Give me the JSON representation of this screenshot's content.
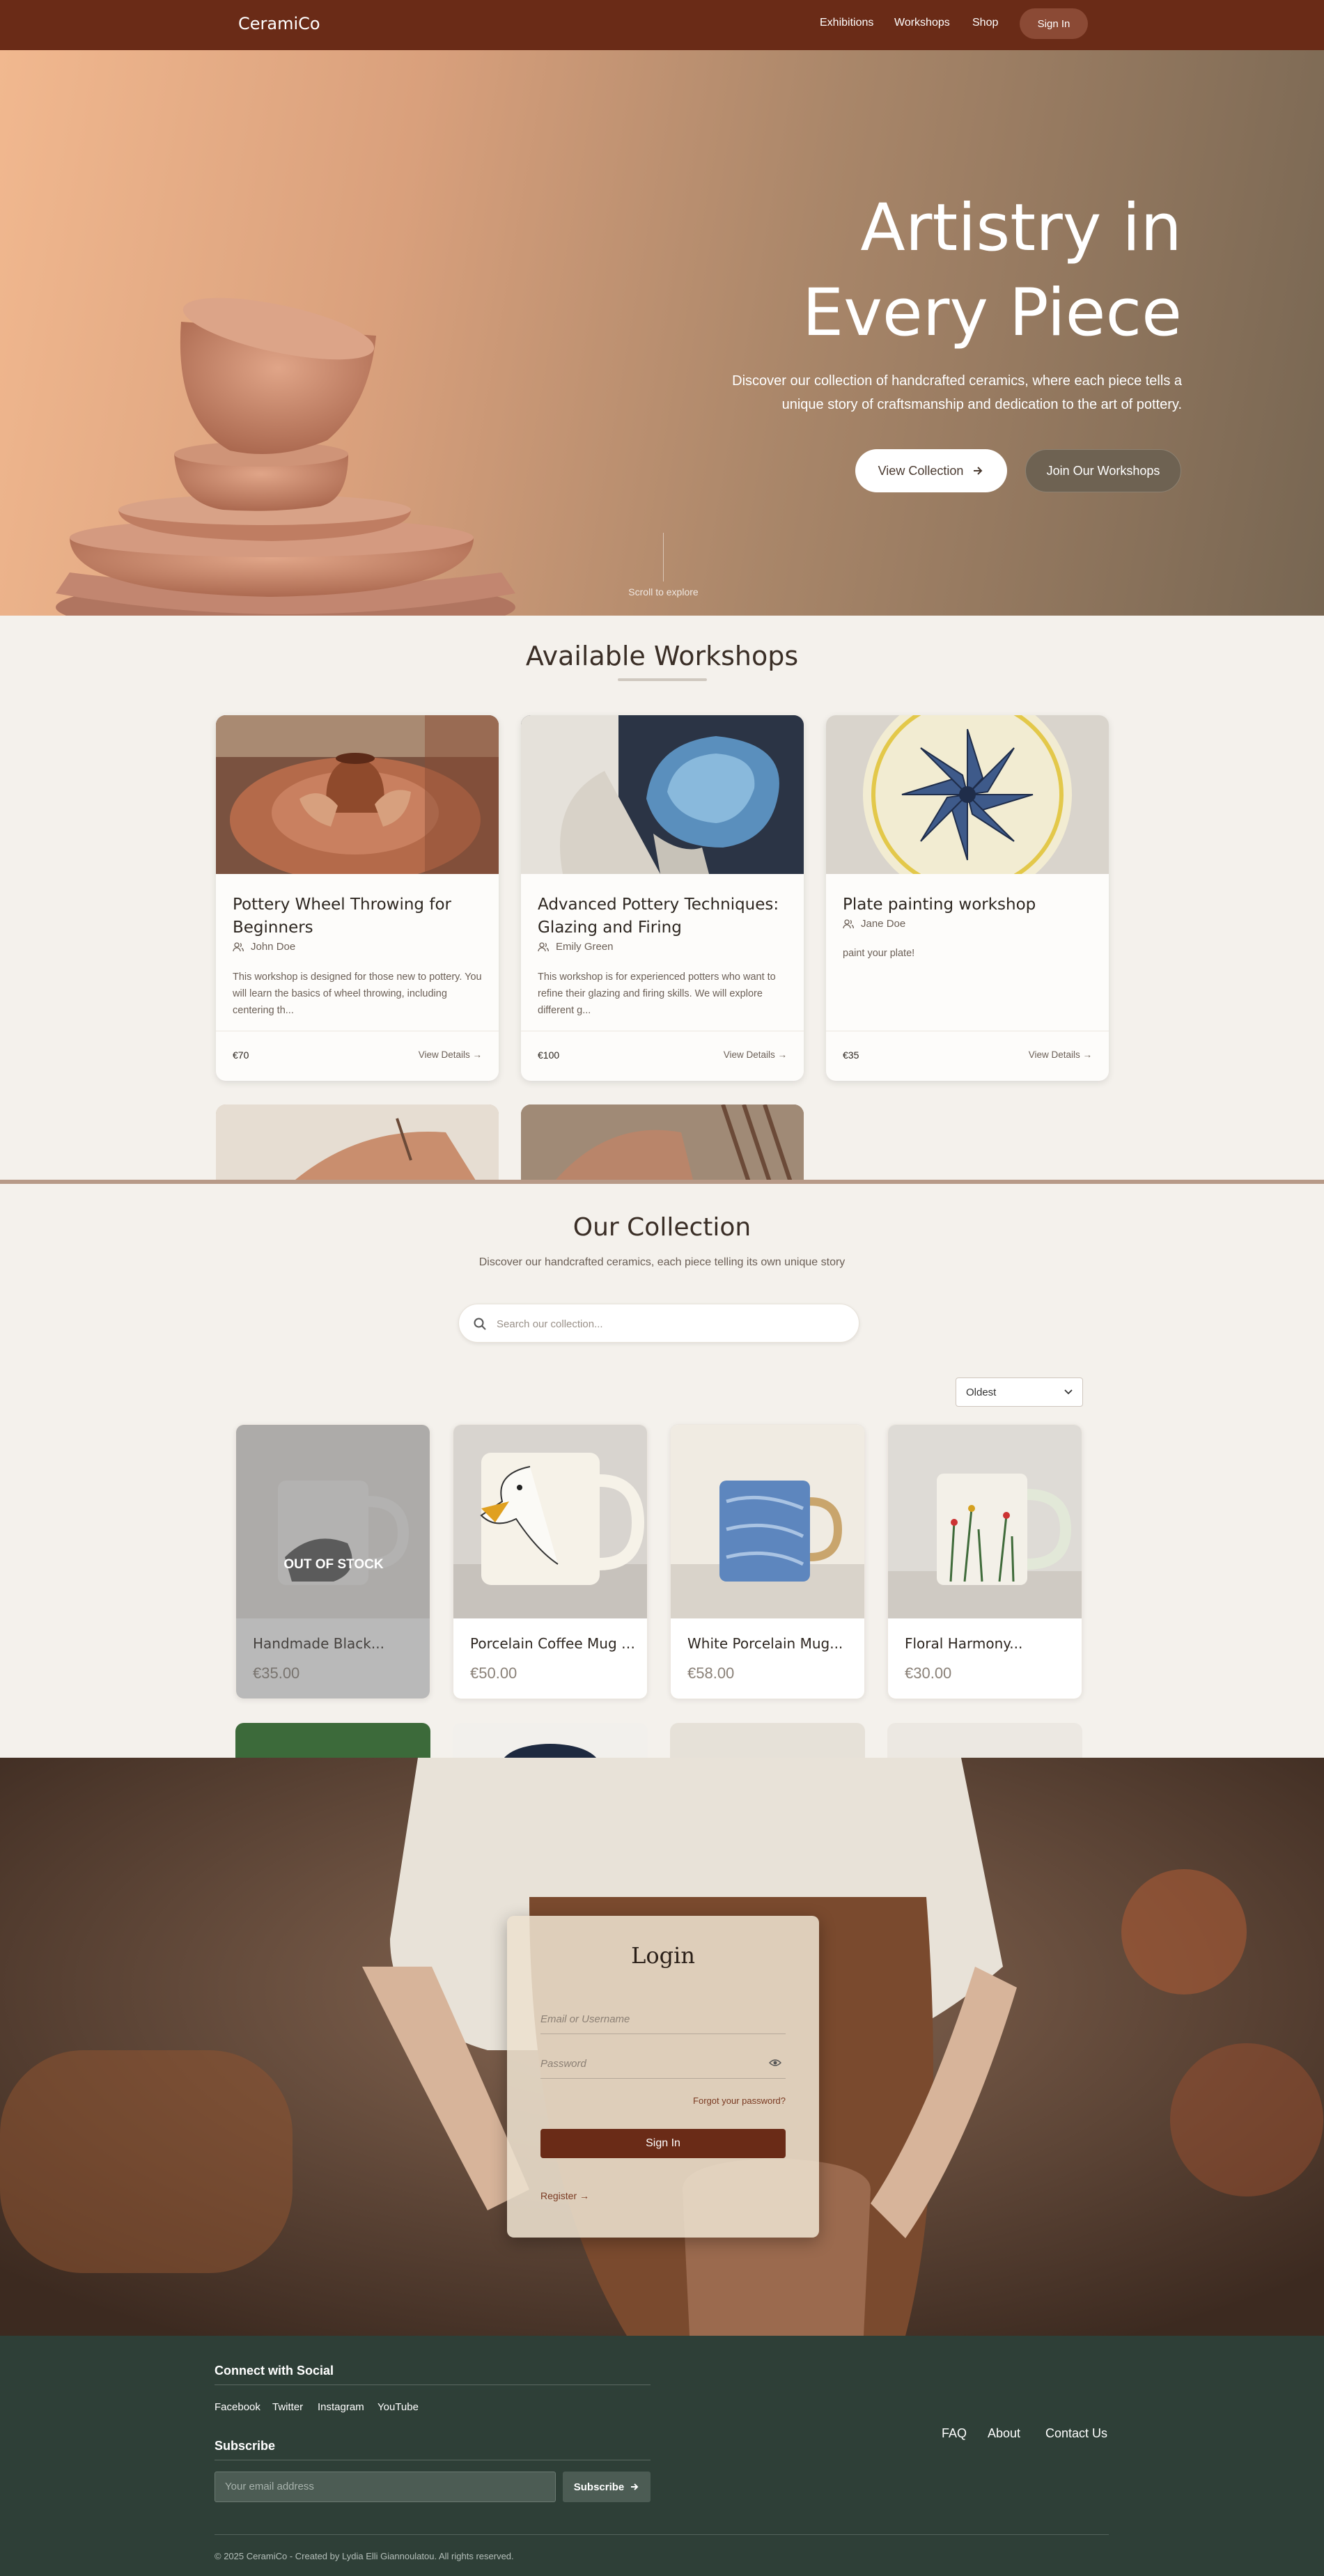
{
  "nav": {
    "brand": "CeramiCo",
    "links": [
      "Exhibitions",
      "Workshops",
      "Shop"
    ],
    "signin": "Sign In"
  },
  "hero": {
    "title_line1": "Artistry in",
    "title_line2": "Every Piece",
    "subtitle_line1": "Discover our collection of handcrafted ceramics, where each piece tells a",
    "subtitle_line2": "unique story of craftsmanship and dedication to the art of pottery.",
    "primary_button": "View Collection",
    "secondary_button": "Join Our Workshops",
    "scroll_hint": "Scroll to explore"
  },
  "workshops": {
    "title": "Available Workshops",
    "cards": [
      {
        "title": "Pottery Wheel Throwing for Beginners",
        "instructor": "John Doe",
        "description": "This workshop is designed for those new to pottery. You will learn the basics of wheel throwing, including centering th...",
        "price": "€70",
        "details": "View Details →"
      },
      {
        "title": "Advanced Pottery Techniques: Glazing and Firing",
        "instructor": "Emily Green",
        "description": "This workshop is for experienced potters who want to refine their glazing and firing skills. We will explore different g...",
        "price": "€100",
        "details": "View Details →"
      },
      {
        "title": "Plate painting workshop",
        "instructor": "Jane Doe",
        "description": "paint your plate!",
        "price": "€35",
        "details": "View Details →"
      }
    ]
  },
  "collection": {
    "title": "Our Collection",
    "subtitle": "Discover our handcrafted ceramics, each piece telling its own unique story",
    "search_placeholder": "Search our collection...",
    "sort_selected": "Oldest",
    "out_of_stock_label": "OUT OF STOCK",
    "products": [
      {
        "name": "Handmade Black...",
        "price": "€35.00"
      },
      {
        "name": "Porcelain Coffee Mug i...",
        "price": "€50.00"
      },
      {
        "name": "White Porcelain Mug...",
        "price": "€58.00"
      },
      {
        "name": "Floral Harmony...",
        "price": "€30.00"
      }
    ]
  },
  "login": {
    "title": "Login",
    "email_placeholder": "Email or Username",
    "password_placeholder": "Password",
    "forgot": "Forgot your password?",
    "button": "Sign In",
    "register": "Register →"
  },
  "footer": {
    "social_heading": "Connect with Social",
    "social_links": [
      "Facebook",
      "Twitter",
      "Instagram",
      "YouTube"
    ],
    "subscribe_heading": "Subscribe",
    "email_placeholder": "Your email address",
    "subscribe_button": "Subscribe",
    "links": [
      "FAQ",
      "About",
      "Contact Us"
    ],
    "copyright": "© 2025 CeramiCo - Created by Lydia Elli Giannoulatou. All rights reserved."
  },
  "colors": {
    "nav": "#6a2b17",
    "accent": "#6a2b17",
    "footer": "#2e3f37",
    "page_bg": "#f4f1ec"
  }
}
